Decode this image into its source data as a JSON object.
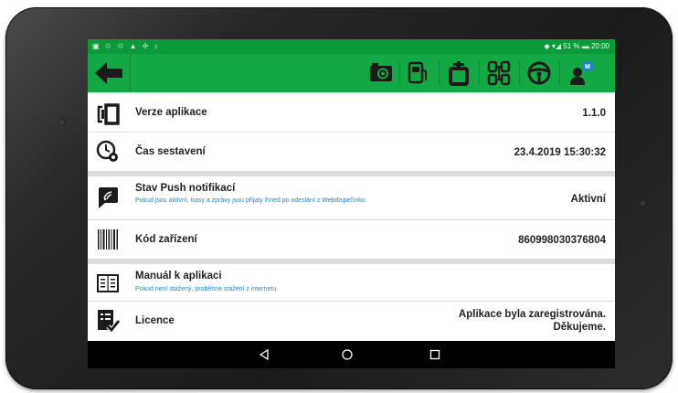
{
  "statusbar": {
    "left_icons": "▣ ♲ ♲ ▲ ✢ ♪",
    "right_text": "51 %",
    "time": "20:00"
  },
  "appbar": {
    "icons": [
      "back-arrow-icon",
      "camera-icon",
      "fuel-icon",
      "tachograph-icon",
      "tires-icon",
      "steering-wheel-icon",
      "dispatcher-message-icon"
    ],
    "badge": "M"
  },
  "rows": {
    "app_version": {
      "label": "Verze aplikace",
      "value": "1.1.0"
    },
    "build_time": {
      "label": "Čas sestavení",
      "value": "23.4.2019 15:30:32"
    },
    "push": {
      "label": "Stav Push notifikací",
      "sub": "Pokud jsou aktivní, trasy a zprávy jsou přijaty ihned po odeslání z Webdispečinku",
      "value": "Aktivní"
    },
    "device_code": {
      "label": "Kód zařízení",
      "value": "860998030376804"
    },
    "manual": {
      "label": "Manuál k aplikaci",
      "sub": "Pokud není stažený, proběhne stažení z internetu."
    },
    "licence": {
      "label": "Licence",
      "value_line1": "Aplikace byla zaregistrována.",
      "value_line2": "Děkujeme."
    }
  },
  "colors": {
    "accent": "#12a844",
    "statusbar": "#0b9a3a",
    "link": "#2b87c4"
  }
}
